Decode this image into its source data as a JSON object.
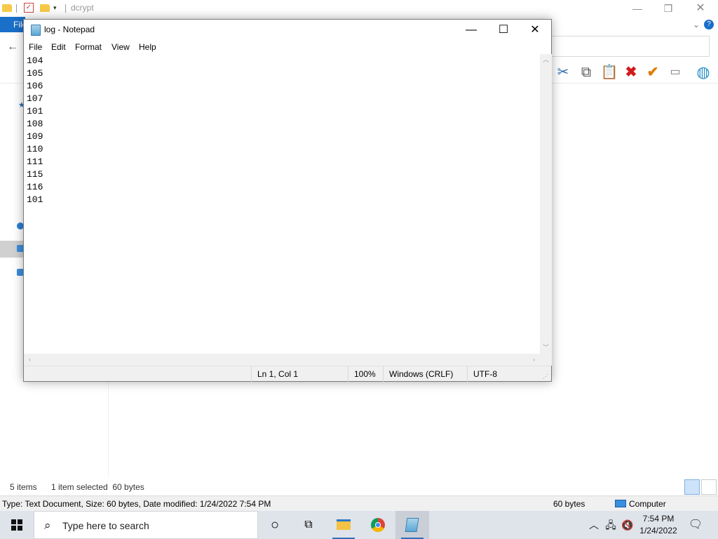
{
  "explorer": {
    "title": "dcrypt",
    "file_tab": "File",
    "status_items": "5 items",
    "status_selected": "1 item selected  60 bytes",
    "detail": "Type: Text Document, Size: 60 bytes, Date modified: 1/24/2022 7:54 PM",
    "detail_size": "60 bytes",
    "detail_location": "Computer"
  },
  "notepad": {
    "title": "log - Notepad",
    "menu": [
      "File",
      "Edit",
      "Format",
      "View",
      "Help"
    ],
    "lines": [
      "104",
      "105",
      "106",
      "107",
      "101",
      "108",
      "109",
      "110",
      "111",
      "115",
      "116",
      "101"
    ],
    "status": {
      "position": "Ln 1, Col 1",
      "zoom": "100%",
      "line_ending": "Windows (CRLF)",
      "encoding": "UTF-8"
    }
  },
  "taskbar": {
    "search_placeholder": "Type here to search",
    "time": "7:54 PM",
    "date": "1/24/2022"
  },
  "colors": {
    "accent": "#1a6fc9",
    "taskbar": "#dfe3ea",
    "delete_red": "#d11b1b",
    "check_orange": "#e07b00"
  }
}
